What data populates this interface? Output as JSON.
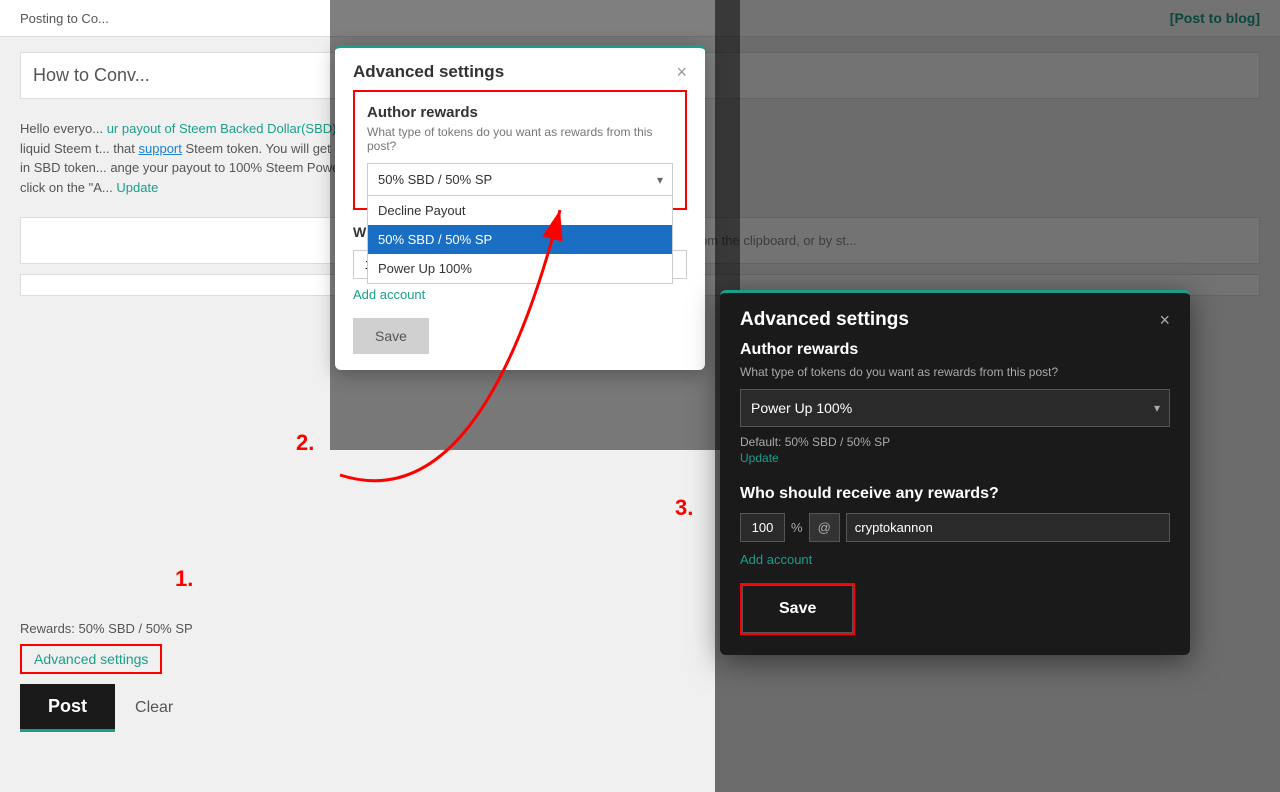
{
  "page": {
    "header": {
      "title": "Posting to Co...",
      "title2": "to Conv...",
      "post_to_blog": "[Post to blog]"
    },
    "content": {
      "title": "How to Conv...",
      "body_text": "Hello everyo... ur payout of Steem Backed Dollar(SBD) into liquid Steem t... that support Steem token. You will get payout in SBD token... ange your payout to 100% Steem Power too by click on the \"A... Update",
      "insert_text": "Insert images by dragging & dropping, pasting from the clipboard, or by st...",
      "rewards_text": "Rewards: 50% SBD / 50% SP"
    },
    "footer": {
      "advanced_settings_label": "Advanced settings",
      "post_btn": "Post",
      "clear_btn": "Clear"
    }
  },
  "modal1": {
    "title": "Advanced settings",
    "close": "×",
    "author_rewards": {
      "title": "Author rewards",
      "desc": "What type of tokens do you want as rewards from this post?",
      "selected": "50% SBD / 50% SP",
      "options": [
        {
          "label": "Decline Payout",
          "value": "decline"
        },
        {
          "label": "50% SBD / 50% SP",
          "value": "50_50",
          "selected": true
        },
        {
          "label": "Power Up 100%",
          "value": "power100"
        }
      ]
    },
    "rewards": {
      "title": "Who should receive any rewards?",
      "percent": "100",
      "percent_label": "%",
      "at": "@",
      "account": "cryptokannon",
      "add_account": "Add account"
    },
    "save_btn": "Save"
  },
  "modal2": {
    "title": "Advanced settings",
    "close": "×",
    "author_rewards": {
      "title": "Author rewards",
      "desc": "What type of tokens do you want as rewards from this post?",
      "selected": "Power Up 100%",
      "default_text": "Default: 50% SBD / 50% SP",
      "update_link": "Update"
    },
    "rewards": {
      "title": "Who should receive any rewards?",
      "percent": "100",
      "percent_label": "%",
      "at": "@",
      "account": "cryptokannon",
      "add_account": "Add account"
    },
    "save_btn": "Save"
  },
  "steps": {
    "step1": "1.",
    "step2": "2.",
    "step3": "3."
  }
}
